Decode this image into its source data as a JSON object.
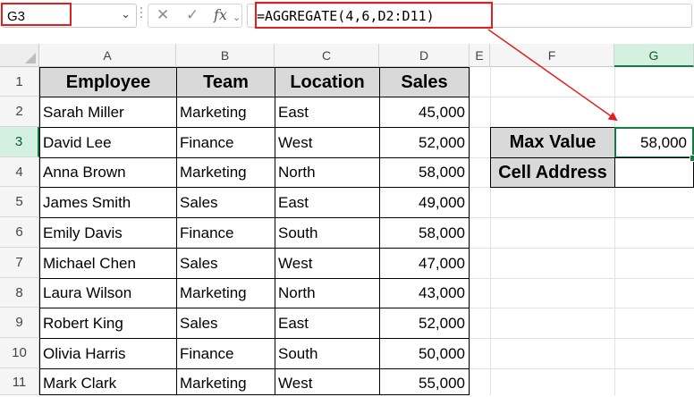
{
  "formula_bar": {
    "name_box": "G3",
    "formula": "=AGGREGATE(4,6,D2:D11)",
    "cancel_icon": "✕",
    "enter_icon": "✓",
    "fx_label": "fx"
  },
  "columns": [
    "A",
    "B",
    "C",
    "D",
    "E",
    "F",
    "G"
  ],
  "rows": [
    "1",
    "2",
    "3",
    "4",
    "5",
    "6",
    "7",
    "8",
    "9",
    "10",
    "11"
  ],
  "table": {
    "headers": [
      "Employee",
      "Team",
      "Location",
      "Sales"
    ],
    "rows": [
      [
        "Sarah Miller",
        "Marketing",
        "East",
        "45,000"
      ],
      [
        "David Lee",
        "Finance",
        "West",
        "52,000"
      ],
      [
        "Anna Brown",
        "Marketing",
        "North",
        "58,000"
      ],
      [
        "James Smith",
        "Sales",
        "East",
        "49,000"
      ],
      [
        "Emily Davis",
        "Finance",
        "South",
        "58,000"
      ],
      [
        "Michael Chen",
        "Sales",
        "West",
        "47,000"
      ],
      [
        "Laura Wilson",
        "Marketing",
        "North",
        "43,000"
      ],
      [
        "Robert King",
        "Sales",
        "East",
        "52,000"
      ],
      [
        "Olivia Harris",
        "Finance",
        "South",
        "50,000"
      ],
      [
        "Mark Clark",
        "Marketing",
        "West",
        "55,000"
      ]
    ]
  },
  "summary": {
    "max_label": "Max Value",
    "max_value": "58,000",
    "address_label": "Cell Address",
    "address_value": ""
  },
  "colors": {
    "annotation": "#e02020",
    "selection": "#107c41",
    "header_fill": "#d9d9d9"
  }
}
